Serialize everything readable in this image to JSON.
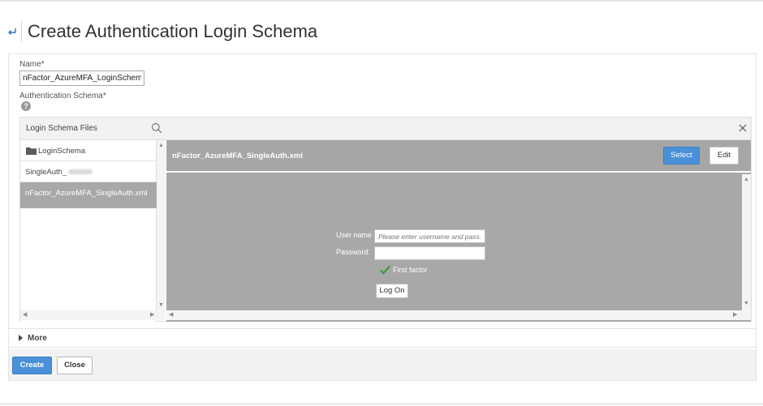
{
  "page": {
    "title": "Create Authentication Login Schema",
    "back_icon": "back-arrow-icon"
  },
  "form": {
    "name_label": "Name*",
    "name_value": "nFactor_AzureMFA_LoginSchema",
    "schema_label": "Authentication Schema*",
    "help_icon_text": "?"
  },
  "browser": {
    "files_title": "Login Schema Files",
    "files": [
      {
        "label": "LoginSchema",
        "type": "folder"
      },
      {
        "label": "SingleAuth_",
        "type": "file"
      },
      {
        "label": "nFactor_AzureMFA_SingleAuth.xml",
        "type": "file",
        "selected": true
      }
    ],
    "preview_file": "nFactor_AzureMFA_SingleAuth.xml",
    "select_label": "Select",
    "edit_label": "Edit",
    "login_preview": {
      "user_label": "User name",
      "user_placeholder": "Please enter username and pass...",
      "password_label": "Password:",
      "first_factor": "First factor",
      "logon_label": "Log On"
    }
  },
  "more_label": "More",
  "actions": {
    "create_label": "Create",
    "close_label": "Close"
  },
  "colors": {
    "primary": "#4a90d9",
    "preview_bg": "#a8a8a8",
    "check_green": "#3a9a3a"
  }
}
